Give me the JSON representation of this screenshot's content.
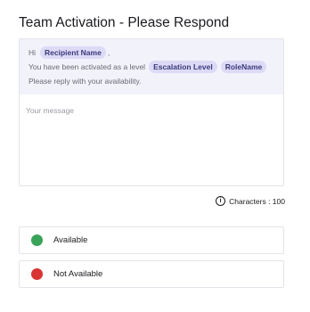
{
  "title": "Team Activation - Please Respond",
  "template": {
    "greeting": "Hi",
    "recipient_chip": "Recipient Name",
    "comma": ",",
    "activated_text": "You have been activated as a level",
    "level_chip": "Escalation Level",
    "role_chip": "RoleName",
    "reply_text": "Please reply with your availability."
  },
  "message": {
    "placeholder": "Your message"
  },
  "counter": {
    "icon": "info-icon",
    "label": "Characters : 100"
  },
  "options": [
    {
      "label": "Available",
      "color": "#3aa35a",
      "icon": "green-dot-icon"
    },
    {
      "label": "Not Available",
      "color": "#d93434",
      "icon": "red-dot-icon"
    }
  ]
}
